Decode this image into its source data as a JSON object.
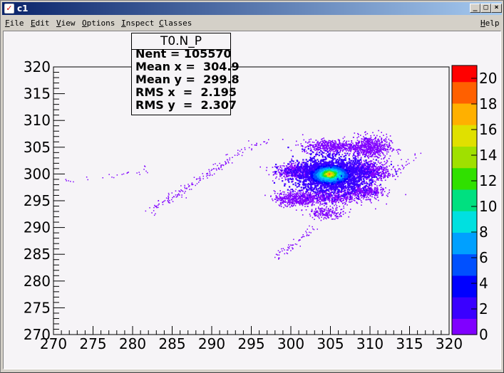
{
  "window": {
    "title": "c1",
    "buttons": [
      "_",
      "□",
      "×"
    ]
  },
  "menu": {
    "items": [
      {
        "pre": "",
        "u": "F",
        "post": "ile"
      },
      {
        "pre": "",
        "u": "E",
        "post": "dit"
      },
      {
        "pre": "",
        "u": "V",
        "post": "iew"
      },
      {
        "pre": "",
        "u": "O",
        "post": "ptions"
      },
      {
        "pre": "",
        "u": "I",
        "post": "nspect"
      },
      {
        "pre": "",
        "u": "C",
        "post": "lasses"
      }
    ],
    "help": {
      "pre": "",
      "u": "H",
      "post": "elp"
    }
  },
  "stats": {
    "title": "T0.N_P",
    "lines": [
      "Nent = 105570",
      "Mean x =  304.9",
      "Mean y =  299.8",
      "RMS x  =  2.195",
      "RMS y  =  2.307"
    ]
  },
  "chart_data": {
    "type": "heatmap",
    "title": "",
    "xlabel": "",
    "ylabel": "",
    "xlim": [
      270,
      320
    ],
    "ylim": [
      270,
      320
    ],
    "xticks": [
      270,
      275,
      280,
      285,
      290,
      295,
      300,
      305,
      310,
      315,
      320
    ],
    "yticks": [
      270,
      275,
      280,
      285,
      290,
      295,
      300,
      305,
      310,
      315,
      320
    ],
    "zlim": [
      0,
      21
    ],
    "zticks": [
      0,
      2,
      4,
      6,
      8,
      10,
      12,
      14,
      16,
      18,
      20
    ],
    "palette": [
      "#8000ff",
      "#3a00ff",
      "#0000ff",
      "#0050ff",
      "#00a0ff",
      "#00e0e0",
      "#00e080",
      "#30e000",
      "#a0e000",
      "#e0e000",
      "#ffb000",
      "#ff6000",
      "#ff0000"
    ],
    "entries": 105570,
    "mean_x": 304.9,
    "mean_y": 299.8,
    "rms_x": 2.195,
    "rms_y": 2.307,
    "clusters": [
      {
        "cx": 304.9,
        "cy": 300.0,
        "sx": 1.0,
        "sy": 0.7,
        "n": 1400,
        "level": 8
      },
      {
        "cx": 304.8,
        "cy": 300.1,
        "sx": 0.45,
        "sy": 0.35,
        "n": 260,
        "level": 11
      },
      {
        "cx": 305.0,
        "cy": 300.0,
        "sx": 2.3,
        "sy": 1.6,
        "n": 2200,
        "level": 1
      },
      {
        "cx": 300.6,
        "cy": 300.6,
        "sx": 1.3,
        "sy": 0.7,
        "n": 500,
        "level": 0
      },
      {
        "cx": 309.8,
        "cy": 300.6,
        "sx": 1.4,
        "sy": 0.9,
        "n": 600,
        "level": 0
      },
      {
        "cx": 309.9,
        "cy": 305.0,
        "sx": 1.3,
        "sy": 1.1,
        "n": 650,
        "level": 0
      },
      {
        "cx": 305.0,
        "cy": 305.3,
        "sx": 1.8,
        "sy": 0.6,
        "n": 500,
        "level": 0
      },
      {
        "cx": 300.5,
        "cy": 295.5,
        "sx": 1.3,
        "sy": 0.7,
        "n": 450,
        "level": 0
      },
      {
        "cx": 305.0,
        "cy": 295.7,
        "sx": 2.2,
        "sy": 0.7,
        "n": 550,
        "level": 0
      },
      {
        "cx": 309.3,
        "cy": 296.8,
        "sx": 1.2,
        "sy": 0.6,
        "n": 350,
        "level": 0
      },
      {
        "cx": 304.5,
        "cy": 292.8,
        "sx": 1.2,
        "sy": 0.5,
        "n": 180,
        "level": 0
      }
    ],
    "streaks": [
      {
        "x0": 282.0,
        "y0": 293.0,
        "x1": 292.5,
        "y1": 303.0,
        "n": 140,
        "level": 0
      },
      {
        "x0": 292.0,
        "y0": 303.0,
        "x1": 297.0,
        "y1": 306.5,
        "n": 30,
        "level": 0
      },
      {
        "x0": 298.0,
        "y0": 284.5,
        "x1": 303.0,
        "y1": 290.0,
        "n": 60,
        "level": 0
      },
      {
        "x0": 311.0,
        "y0": 299.0,
        "x1": 317.0,
        "y1": 304.0,
        "n": 25,
        "level": 0
      },
      {
        "x0": 270.5,
        "y0": 298.5,
        "x1": 283.0,
        "y1": 301.0,
        "n": 25,
        "level": 0
      }
    ]
  }
}
